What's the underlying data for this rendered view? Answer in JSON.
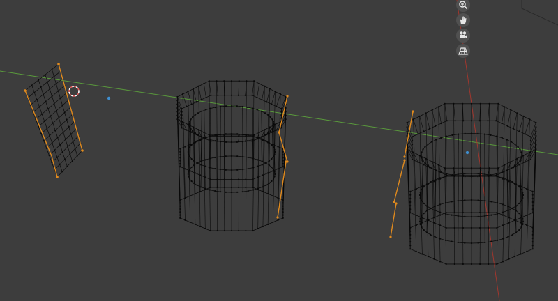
{
  "viewport": {
    "mode": "wireframe-edit",
    "colors": {
      "background": "#3d3d3d",
      "wire": "#0a0a0a",
      "selected_edge": "#e08a1e",
      "x_axis": "#a0372e",
      "y_axis": "#5a9a3c",
      "origin": "#3f8fd0",
      "cursor_ring_a": "#e05a5a",
      "cursor_ring_b": "#ffffff"
    }
  },
  "nav_gizmo": {
    "buttons": [
      {
        "name": "zoom-icon"
      },
      {
        "name": "hand-pan-icon"
      },
      {
        "name": "camera-icon"
      },
      {
        "name": "perspective-grid-icon"
      }
    ]
  },
  "objects": [
    {
      "name": "plane-mesh",
      "type": "plane"
    },
    {
      "name": "cup-mesh-center",
      "type": "octagonal-cup"
    },
    {
      "name": "cup-mesh-right",
      "type": "octagonal-cup"
    }
  ]
}
